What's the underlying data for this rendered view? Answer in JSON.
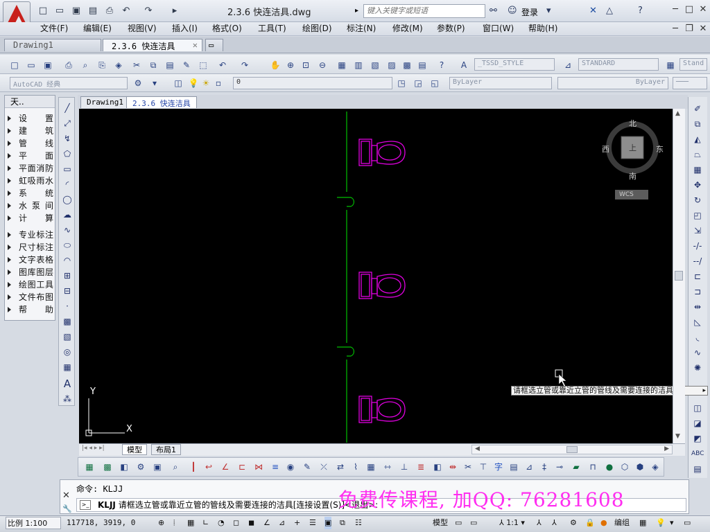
{
  "title": {
    "file_title": "2.3.6  快连洁具.dwg",
    "search_placeholder": "键入关键字或短语",
    "login": "登录"
  },
  "menus": [
    "文件(F)",
    "编辑(E)",
    "视图(V)",
    "插入(I)",
    "格式(O)",
    "工具(T)",
    "绘图(D)",
    "标注(N)",
    "修改(M)",
    "参数(P)",
    "窗口(W)",
    "帮助(H)"
  ],
  "file_tabs": [
    "Drawing1",
    "2.3.6  快连洁具"
  ],
  "toolbar": {
    "style_combo": "_TSSD_STYLE",
    "dimstyle_combo": "STANDARD",
    "standard_combo": "Stand",
    "workspace_combo": "AutoCAD 经典",
    "layer_combo": "0",
    "color_combo": "ByLayer",
    "linetype_combo": "ByLayer"
  },
  "left_panel": {
    "header": "天..",
    "items": [
      "设  置",
      "建  筑",
      "管  线",
      "平  面",
      "平面消防",
      "虹吸雨水",
      "系  统",
      "水 泵 间",
      "计  算",
      "专业标注",
      "尺寸标注",
      "文字表格",
      "图库图层",
      "绘图工具",
      "文件布图",
      "帮  助"
    ]
  },
  "doc_tabs": [
    "Drawing1",
    "2.3.6  快连洁具"
  ],
  "viewcube": {
    "north": "北",
    "south": "南",
    "east": "东",
    "west": "西",
    "top": "上",
    "wcs": "WCS"
  },
  "layout_tabs": [
    "模型",
    "布局1"
  ],
  "tooltip": "请框选立管或靠近立管的管线及需要连接的洁具",
  "command": {
    "prev": "命令: KLJJ",
    "current_cmd": "KLJJ",
    "current_prompt": "请框选立管或靠近立管的管线及需要连接的洁具[连接设置(S)]<退出>:"
  },
  "watermark": "免费传课程, 加QQ: 76281608",
  "status": {
    "scale": "比例 1:100",
    "coords": "117718, 3919, 0",
    "model": "模型",
    "annot_scale": "1:1",
    "workspace": "编组"
  },
  "ucs": {
    "x": "X",
    "y": "Y"
  },
  "colors": {
    "canvas": "#000000",
    "pipe": "#00c000",
    "fixture": "#e000e0",
    "watermark": "#ff2ef0"
  }
}
